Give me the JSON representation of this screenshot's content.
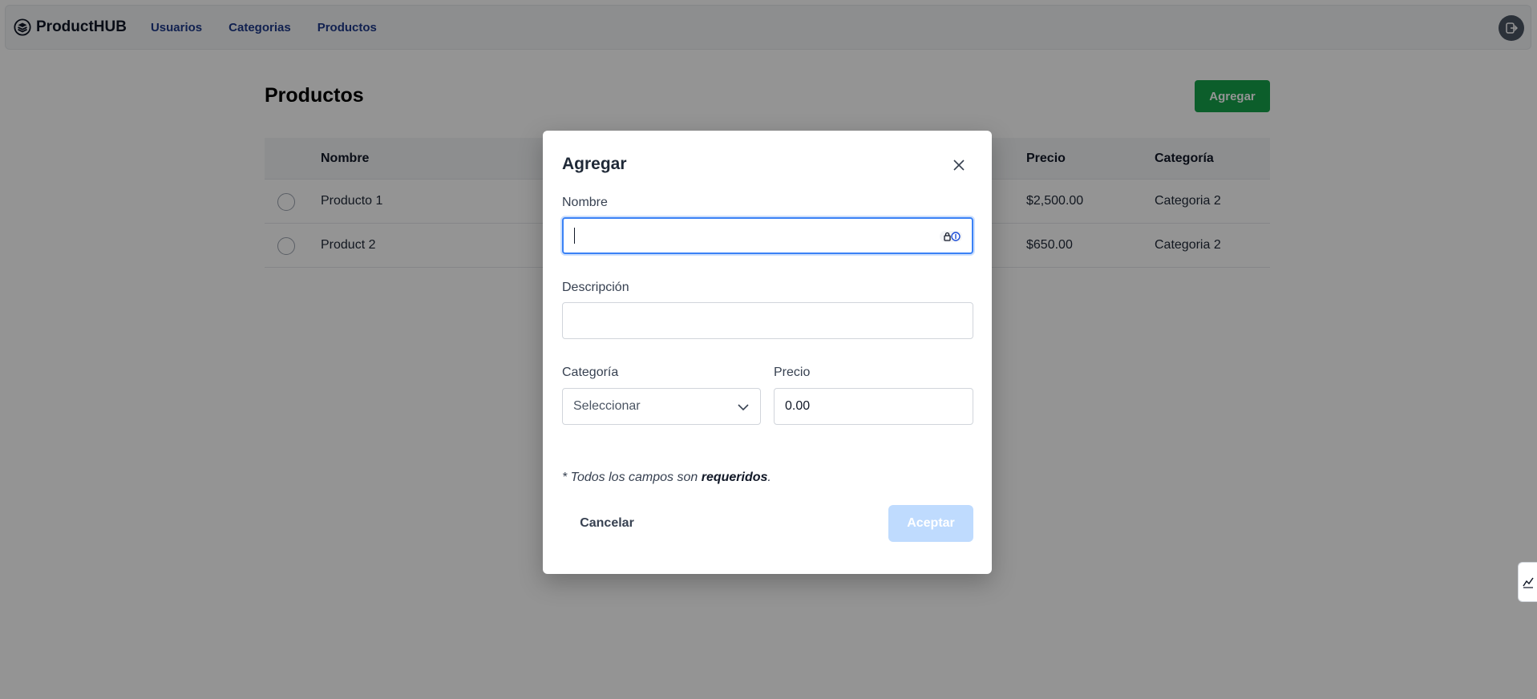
{
  "navbar": {
    "brand": "ProductHUB",
    "links": [
      "Usuarios",
      "Categorias",
      "Productos"
    ],
    "logout_icon": "logout-icon"
  },
  "page": {
    "title": "Productos",
    "add_label": "Agregar"
  },
  "table": {
    "headers": [
      "Nombre",
      "Precio",
      "Categoría"
    ],
    "rows": [
      {
        "name": "Producto 1",
        "price": "$2,500.00",
        "category": "Categoria 2"
      },
      {
        "name": "Product 2",
        "price": "$650.00",
        "category": "Categoria 2"
      }
    ]
  },
  "modal": {
    "title": "Agregar",
    "fields": {
      "nombre_label": "Nombre",
      "nombre_value": "",
      "descripcion_label": "Descripción",
      "descripcion_value": "",
      "categoria_label": "Categoría",
      "categoria_value": "Seleccionar",
      "precio_label": "Precio",
      "precio_value": "0.00"
    },
    "note_prefix": "* Todos los campos son ",
    "note_bold": "requeridos",
    "note_suffix": ".",
    "cancel_label": "Cancelar",
    "accept_label": "Aceptar"
  },
  "colors": {
    "accent_green": "#16a34a",
    "nav_link": "#1e3a8a",
    "focus_blue": "#3b82f6",
    "disabled_button": "#bfdbfe"
  }
}
